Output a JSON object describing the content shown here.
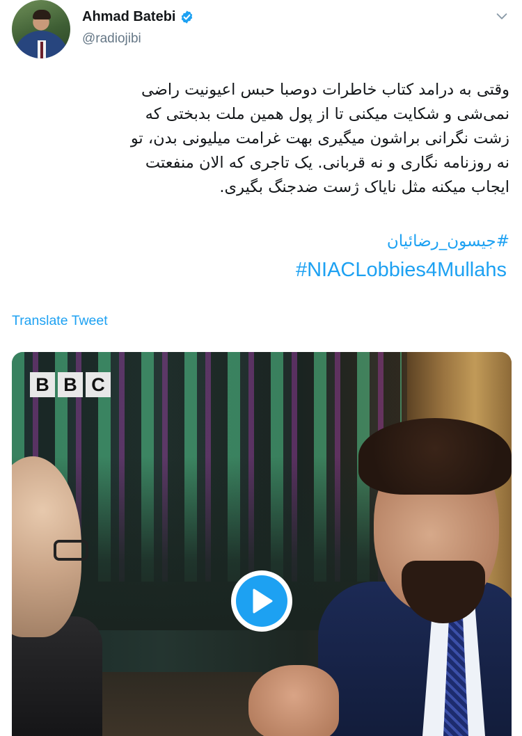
{
  "author": {
    "name": "Ahmad Batebi",
    "handle": "@radiojibi",
    "verified": true
  },
  "tweet": {
    "lines": [
      "وقتی به درامد کتاب خاطرات دوصبا حبس اعیونیت راضی",
      "نمی‌شی و شکایت میکنی تا از پول همین ملت بدبختی که",
      "زشت نگرانی براشون میگیری بهت غرامت میلیونی بدن، تو",
      "نه روزنامه نگاری و نه قربانی. یک تاجری که الان منفعتت",
      "ایجاب میکنه مثل نایاک ژست ضدجنگ بگیری."
    ],
    "hashtags": [
      "#جیسون_رضائیان",
      "#NIACLobbies4Mullahs"
    ],
    "translate_label": "Translate Tweet"
  },
  "media": {
    "watermark_letters": [
      "B",
      "B",
      "C"
    ],
    "play_icon": "play-icon"
  },
  "icons": {
    "verified": "verified-badge-icon",
    "menu": "chevron-down-icon"
  },
  "colors": {
    "accent": "#1da1f2",
    "handle": "#657786",
    "text": "#14171a"
  }
}
